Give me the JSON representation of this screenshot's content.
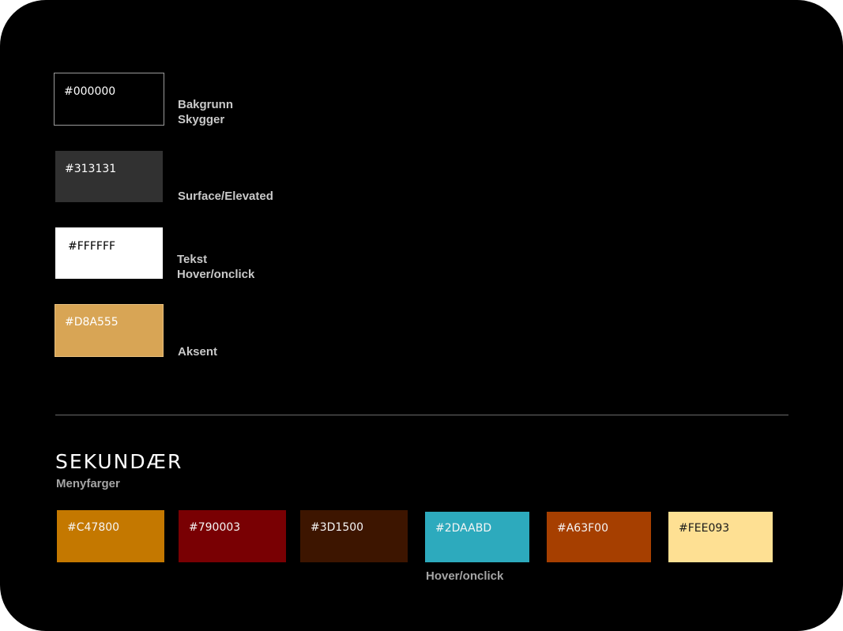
{
  "primary": {
    "black": {
      "hex": "#000000",
      "roles": [
        "Bakgrunn",
        "Skygger"
      ],
      "color": "#000000"
    },
    "surface": {
      "hex": "#313131",
      "roles": [
        "Surface/Elevated"
      ],
      "color": "#313131"
    },
    "white": {
      "hex": "#FFFFFF",
      "roles": [
        "Tekst",
        "Hover/onclick"
      ],
      "color": "#FFFFFF"
    },
    "accent": {
      "hex": "#D8A555",
      "roles": [
        "Aksent"
      ],
      "color": "#D8A555"
    }
  },
  "secondary": {
    "title": "SEKUNDÆR",
    "subtitle": "Menyfarger",
    "swatches": [
      {
        "hex": "#C47800",
        "color": "#C47800"
      },
      {
        "hex": "#790003",
        "color": "#790003"
      },
      {
        "hex": "#3D1500",
        "color": "#3D1500"
      },
      {
        "hex": "#2DAABD",
        "color": "#2DAABD",
        "label": "Hover/onclick"
      },
      {
        "hex": "#A63F00",
        "color": "#A63F00"
      },
      {
        "hex": "#FEE093",
        "color": "#FEE093"
      }
    ]
  }
}
